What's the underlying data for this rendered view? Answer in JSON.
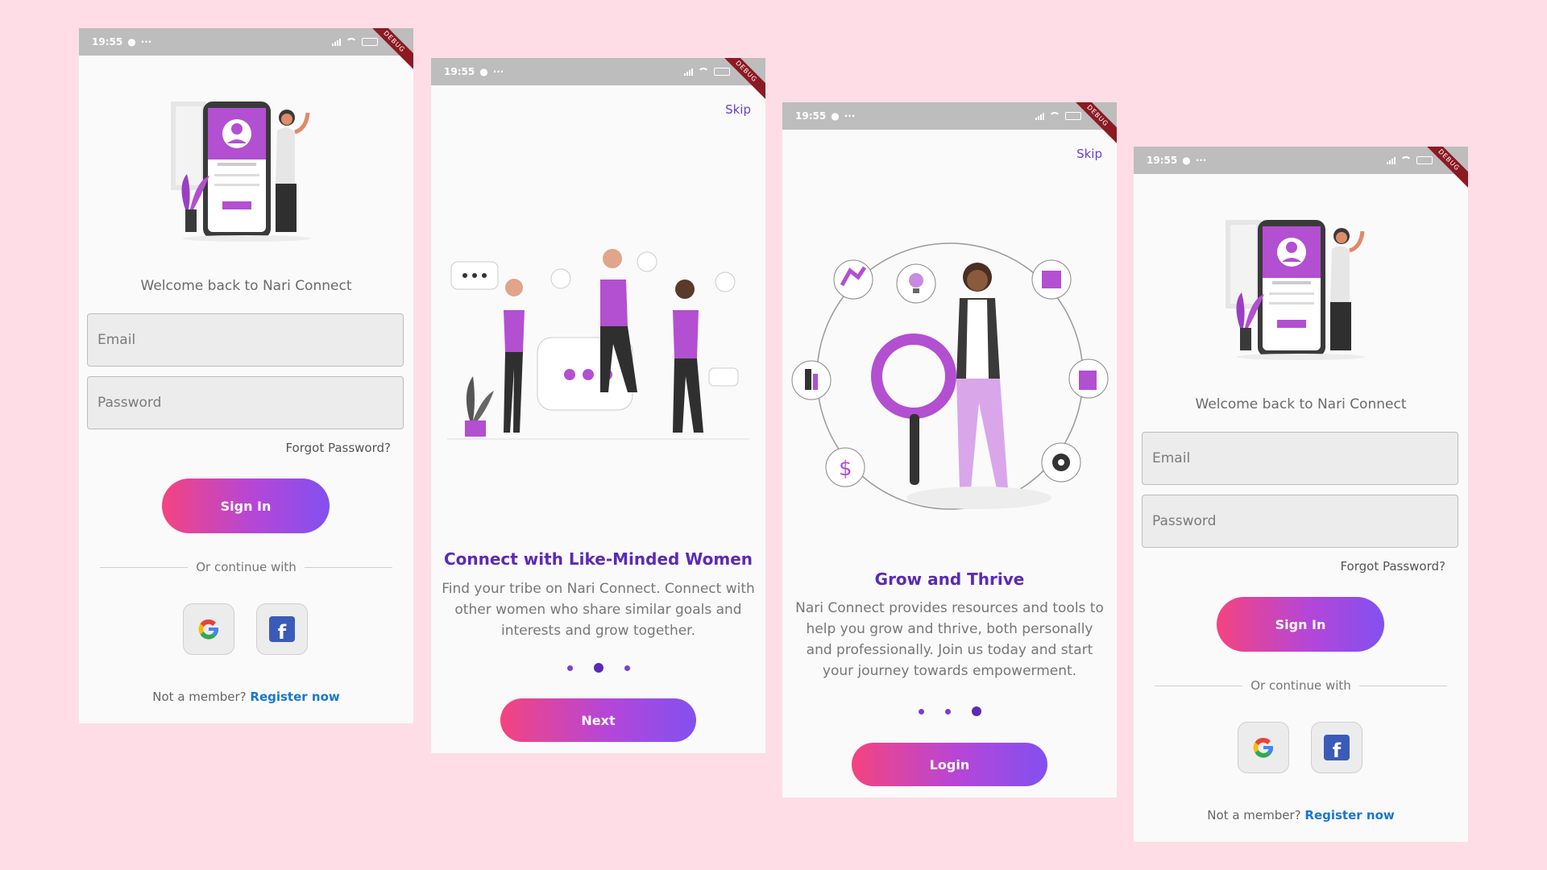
{
  "status": {
    "time": "19:55",
    "ribbon": "DEBUG"
  },
  "colors": {
    "page_bg": "#ffdde6",
    "gradient_start": "#f4447f",
    "gradient_end": "#8250f0",
    "title_purple": "#5b2ab5",
    "link_blue": "#1976d2"
  },
  "login": {
    "welcome": "Welcome back to Nari Connect",
    "email_placeholder": "Email",
    "password_placeholder": "Password",
    "forgot": "Forgot Password?",
    "sign_in": "Sign In",
    "or_continue": "Or continue with",
    "google_icon": "google-icon",
    "facebook_icon": "facebook-icon",
    "not_member": "Not a member?",
    "register": "Register now"
  },
  "onboarding1": {
    "skip": "Skip",
    "title": "Connect with Like-Minded Women",
    "body": "Find your tribe on Nari Connect. Connect with other women who share similar goals and interests and grow together.",
    "button": "Next"
  },
  "onboarding2": {
    "skip": "Skip",
    "title": "Grow and Thrive",
    "body": "Nari Connect provides resources and tools to help you grow and thrive, both personally and professionally. Join us today and start your journey towards empowerment.",
    "button": "Login"
  }
}
